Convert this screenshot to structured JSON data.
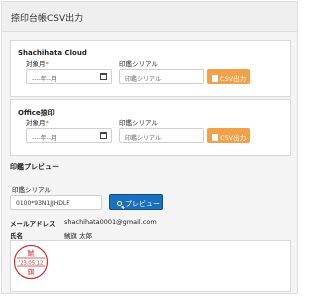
{
  "page": {
    "title": "捺印台帳CSV出力"
  },
  "cloud_section": {
    "title": "Shachihata Cloud",
    "target_month_label": "対象月",
    "required_mark": "*",
    "month_placeholder": "----年--月",
    "seal_serial_label": "印鑑シリアル",
    "seal_serial_placeholder": "印鑑シリアル",
    "csv_button": "CSV出力"
  },
  "office_section": {
    "title": "Office捺印",
    "target_month_label": "対象月",
    "required_mark": "*",
    "month_placeholder": "----年--月",
    "seal_serial_label": "印鑑シリアル",
    "seal_serial_placeholder": "印鑑シリアル",
    "csv_button": "CSV出力"
  },
  "preview": {
    "title": "印鑑プレビュー",
    "seal_serial_label": "印鑑シリアル",
    "seal_serial_value": "0100*93N1JJHDLF",
    "preview_button": "プレビュー",
    "email_label": "メールアドレス",
    "email_value": "shachihata0001@gmail.com",
    "name_label": "氏名",
    "name_value": "鯱旗 太郎"
  },
  "stamp": {
    "top_text": "鯱",
    "date_text": "'23.05.12",
    "bottom_text": "旗",
    "color": "#d32f2f"
  },
  "colors": {
    "accent_orange": "#f0a14a",
    "primary_blue": "#1a6fbf",
    "required_red": "#e53935"
  }
}
